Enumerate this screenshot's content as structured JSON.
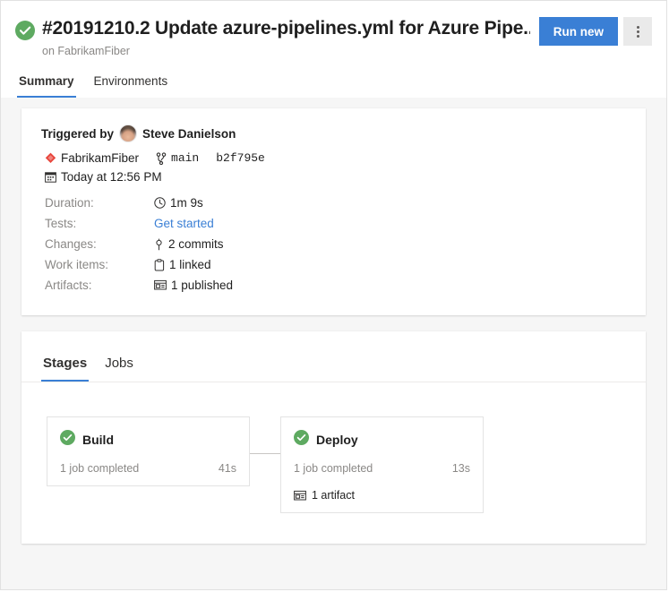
{
  "header": {
    "status_icon": "success-check-icon",
    "title": "#20191210.2 Update azure-pipelines.yml for Azure Pipe...",
    "subtitle": "on FabrikamFiber",
    "run_new_label": "Run new",
    "more_actions_icon": "more-vertical-icon",
    "tabs": [
      {
        "label": "Summary",
        "active": true
      },
      {
        "label": "Environments",
        "active": false
      }
    ]
  },
  "summary": {
    "triggered_by_label": "Triggered by",
    "avatar_icon": "user-avatar",
    "triggered_by_user": "Steve Danielson",
    "repo_icon": "azure-repos-icon",
    "repo_name": "FabrikamFiber",
    "branch_icon": "branch-icon",
    "branch_name": "main",
    "commit_hash": "b2f795e",
    "date_icon": "calendar-icon",
    "date_text": "Today at 12:56 PM",
    "details": [
      {
        "label": "Duration:",
        "icon": "clock-icon",
        "value": "1m 9s",
        "is_link": false
      },
      {
        "label": "Tests:",
        "icon": "",
        "value": "Get started",
        "is_link": true
      },
      {
        "label": "Changes:",
        "icon": "commit-icon",
        "value": "2 commits",
        "is_link": false
      },
      {
        "label": "Work items:",
        "icon": "work-item-icon",
        "value": "1 linked",
        "is_link": false
      },
      {
        "label": "Artifacts:",
        "icon": "artifact-icon",
        "value": "1 published",
        "is_link": false
      }
    ]
  },
  "stages_section": {
    "tabs": [
      {
        "label": "Stages",
        "active": true
      },
      {
        "label": "Jobs",
        "active": false
      }
    ],
    "stages": [
      {
        "status_icon": "success-check-icon",
        "name": "Build",
        "jobs_text": "1 job completed",
        "duration": "41s",
        "artifact_icon": "",
        "artifact_text": ""
      },
      {
        "status_icon": "success-check-icon",
        "name": "Deploy",
        "jobs_text": "1 job completed",
        "duration": "13s",
        "artifact_icon": "artifact-icon",
        "artifact_text": "1 artifact"
      }
    ]
  },
  "colors": {
    "accent": "#3a7fd5",
    "success": "#5eaa61",
    "repo_red": "#e8453c",
    "muted_text": "#8a8886",
    "page_bg": "#f6f6f6",
    "card_bg": "#ffffff"
  }
}
